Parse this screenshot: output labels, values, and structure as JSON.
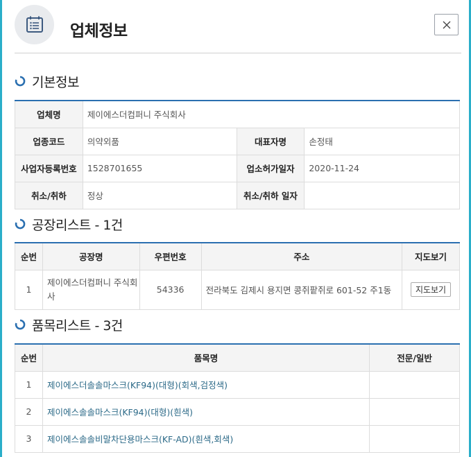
{
  "header": {
    "title": "업체정보",
    "icon": "calendar-list-icon",
    "close_icon": "close-icon"
  },
  "basic": {
    "section_title": "기본정보",
    "labels": {
      "company_name": "업체명",
      "industry_code": "업종코드",
      "representative": "대표자명",
      "business_number": "사업자등록번호",
      "license_date": "업소허가일자",
      "cancel_status": "취소/취하",
      "cancel_date": "취소/취하 일자"
    },
    "values": {
      "company_name": "제이에스더컴퍼니 주식회사",
      "industry_code": "의약외품",
      "representative": "손정태",
      "business_number": "1528701655",
      "license_date": "2020-11-24",
      "cancel_status": "정상",
      "cancel_date": ""
    }
  },
  "factories": {
    "section_title": "공장리스트 - 1건",
    "columns": [
      "순번",
      "공장명",
      "우편번호",
      "주소",
      "지도보기"
    ],
    "rows": [
      {
        "no": "1",
        "name": "제이에스더컴퍼니 주식회사",
        "zip": "54336",
        "address": "전라북도 김제시 용지면 콩쥐팥쥐로 601-52 주1동",
        "map_label": "지도보기"
      }
    ]
  },
  "products": {
    "section_title": "품목리스트 - 3건",
    "columns": [
      "순번",
      "품목명",
      "전문/일반"
    ],
    "rows": [
      {
        "no": "1",
        "name": "제이에스더솔솔마스크(KF94)(대형)(회색,검정색)",
        "type": ""
      },
      {
        "no": "2",
        "name": "제이에스솔솔마스크(KF94)(대형)(흰색)",
        "type": ""
      },
      {
        "no": "3",
        "name": "제이에스솔솔비말차단용마스크(KF-AD)(흰색,회색)",
        "type": ""
      }
    ]
  },
  "colors": {
    "accent": "#2a6fb0",
    "outer": "#2aaec9",
    "link": "#2c6a88"
  }
}
